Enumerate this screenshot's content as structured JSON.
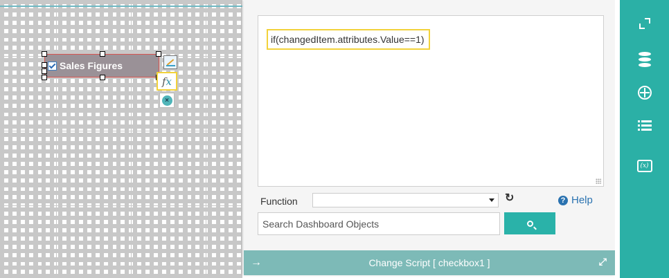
{
  "canvas": {
    "widget": {
      "label": "Sales Figures",
      "checked": true
    },
    "fx_button": {
      "symbol": "f",
      "x": "x"
    },
    "close_symbol": "×"
  },
  "dialog": {
    "editor": {
      "code": "if(changedItem.attributes.Value==1)"
    },
    "function_label": "Function",
    "function_selected": "",
    "help_label": "Help",
    "search_placeholder": "Search Dashboard Objects",
    "footer_title": "Change Script [ checkbox1 ]"
  },
  "toolbar": {
    "items": [
      {
        "icon": "expand-icon"
      },
      {
        "icon": "database-icon"
      },
      {
        "icon": "globe-icon"
      },
      {
        "icon": "list-icon"
      },
      {
        "icon": "function-icon"
      }
    ]
  },
  "colors": {
    "teal": "#2bb0a6",
    "footer_teal": "#7dbab7",
    "highlight": "#f2d23a",
    "widget_bg": "#9a9197",
    "link_blue": "#2a72b0"
  }
}
